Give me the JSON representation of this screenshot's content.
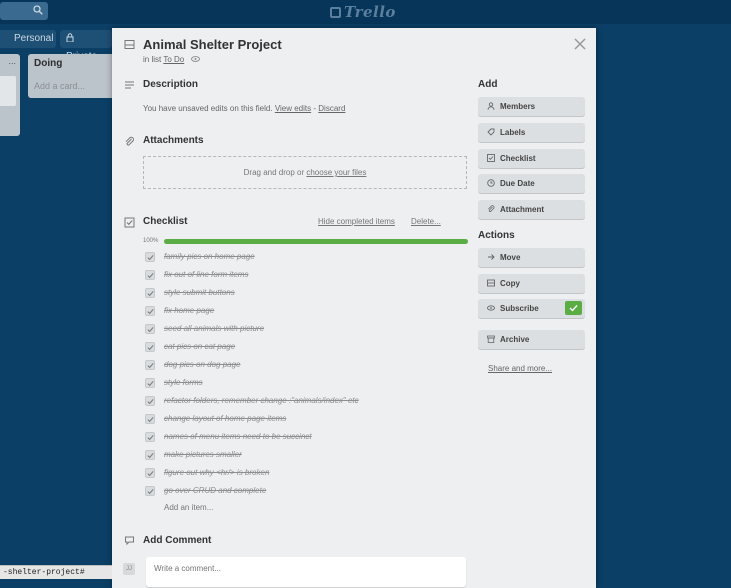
{
  "header": {
    "logo": "Trello"
  },
  "board": {
    "personal_label": "Personal",
    "private_label": "Private",
    "list_first_menu": "...",
    "list_doing_title": "Doing",
    "list_doing_add": "Add a card..."
  },
  "card": {
    "title": "Animal Shelter Project",
    "in_list_prefix": "in list",
    "list_name": "To Do",
    "description": {
      "heading": "Description",
      "unsaved_text": "You have unsaved edits on this field.",
      "view_edits": "View edits",
      "separator": "-",
      "discard": "Discard"
    },
    "attachments": {
      "heading": "Attachments",
      "drop_text": "Drag and drop or",
      "choose_files": "choose your files"
    },
    "checklist": {
      "heading": "Checklist",
      "hide_completed": "Hide completed items",
      "delete": "Delete...",
      "progress_label": "100%",
      "progress": 100,
      "items": [
        "family pics on home page",
        "fix out of line form items",
        "style submit buttons",
        "fix home page",
        "seed all animals with picture",
        "cat pics on cat page",
        "dog pics on dog page",
        "style forms",
        "refactor folders, remember change :\"animals/index\" etc",
        "change layout of home page items",
        "names of menu items need to be succinct",
        "make pictures smaller",
        "figure out why <hr/> is broken",
        "go over CRUD and complete"
      ],
      "add_item": "Add an item..."
    },
    "comment": {
      "heading": "Add Comment",
      "avatar": "JJ",
      "placeholder": "Write a comment..."
    }
  },
  "sidebar": {
    "add_heading": "Add",
    "add_buttons": [
      "Members",
      "Labels",
      "Checklist",
      "Due Date",
      "Attachment"
    ],
    "actions_heading": "Actions",
    "action_buttons": [
      "Move",
      "Copy",
      "Subscribe",
      "Archive"
    ],
    "share": "Share and more..."
  },
  "status_bar": {
    "url": "-shelter-project#"
  },
  "colors": {
    "board_bg": "#0b3f66",
    "modal_bg": "#edeff0",
    "progress_green": "#5aac44"
  }
}
